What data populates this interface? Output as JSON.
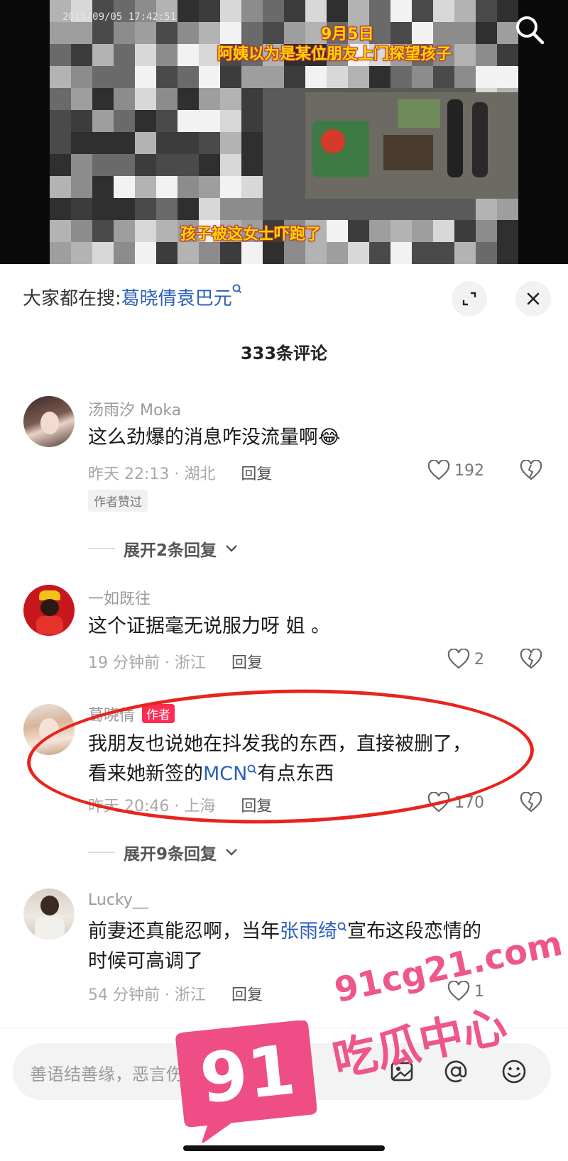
{
  "video": {
    "timestamp": "2016/09/05  17:42:51",
    "caption_top_line1": "9月5日",
    "caption_top_line2": "阿姨以为是某位朋友上门探望孩子",
    "caption_bottom": "孩子被这女士吓跑了"
  },
  "search_bar": {
    "prefix": "大家都在搜:",
    "keyword": "葛晓倩袁巴元"
  },
  "comment_count": "333条评论",
  "comments": [
    {
      "username": "汤雨汐 Moka",
      "text": "这么劲爆的消息咋没流量啊",
      "emoji": "😂",
      "time_location": "昨天 22:13 · 湖北",
      "reply_label": "回复",
      "likes": "192",
      "badge": "作者赞过",
      "expand": "展开2条回复"
    },
    {
      "username": "一如既往",
      "text": "这个证据毫无说服力呀 姐 。",
      "time_location": "19 分钟前 · 浙江",
      "reply_label": "回复",
      "likes": "2"
    },
    {
      "username": "葛晓倩",
      "author_tag": "作者",
      "text_line1": "我朋友也说她在抖发我的东西，直接被删了，",
      "text_line2_pre": "看来她新签的",
      "text_line2_kw": "MCN",
      "text_line2_post": "有点东西",
      "time_location": "昨天 20:46 · 上海",
      "reply_label": "回复",
      "likes": "170",
      "expand": "展开9条回复"
    },
    {
      "username": "Lucky__",
      "text_line1_pre": "前妻还真能忍啊，当年",
      "text_line1_kw": "张雨绮",
      "text_line1_post": "宣布这段恋情的",
      "text_line2": "时候可高调了",
      "time_location": "54 分钟前 · 浙江",
      "reply_label": "回复",
      "likes": "1"
    }
  ],
  "input": {
    "placeholder": "善语结善缘，恶言伤人心"
  },
  "watermark": {
    "number": "91",
    "url": "91cg21.com",
    "name": "吃瓜中心"
  },
  "colors": {
    "link_blue": "#2b5fb8",
    "author_tag": "#fe2c55",
    "highlight_red": "#e8241d",
    "caption_yellow": "#ffd400",
    "watermark_pink": "#ee4d86"
  }
}
